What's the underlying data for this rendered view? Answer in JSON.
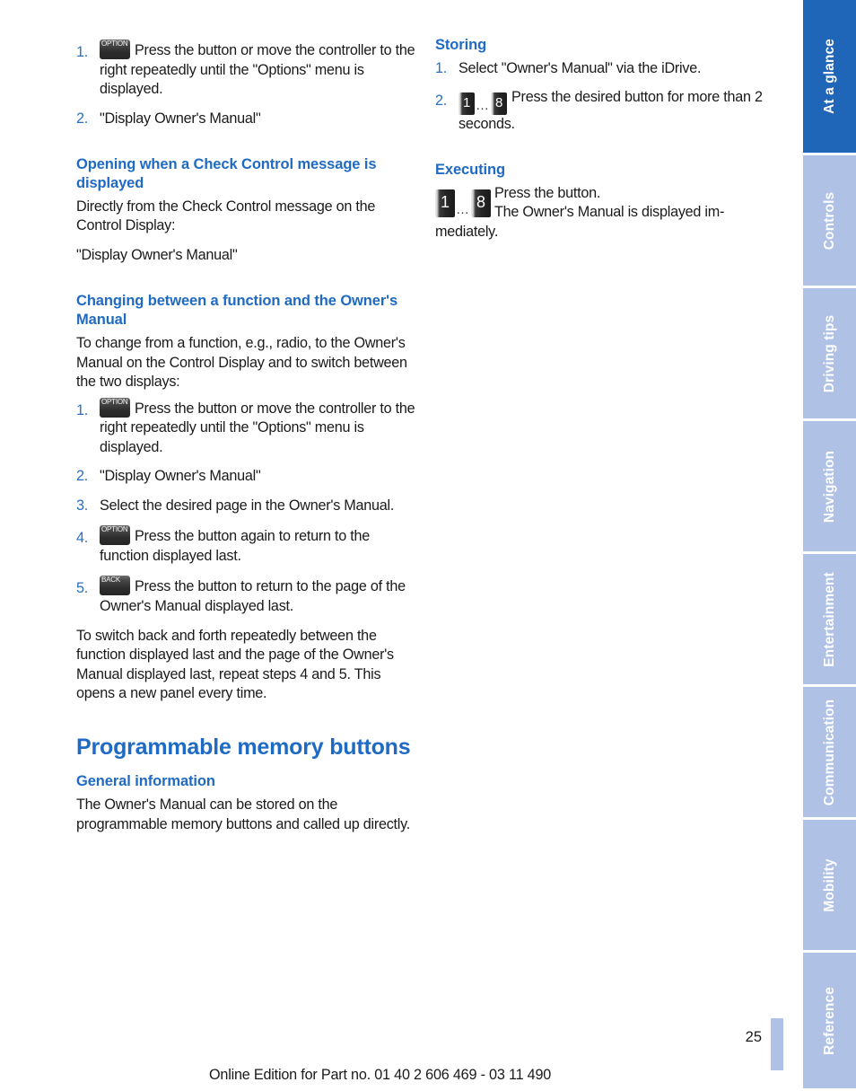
{
  "document": {
    "page_number": "25",
    "footer_text": "Online Edition for Part no. 01 40 2 606 469 - 03 11 490"
  },
  "colors": {
    "heading_blue": "#1f6ac2",
    "tab_active_blue": "#1f65b8",
    "tab_inactive_blue": "#afc1e4",
    "list_number_blue": "#2a6fc0",
    "body_text": "#1a1a1a"
  },
  "tab_rail": {
    "tabs": [
      {
        "label": "At a glance",
        "active": true
      },
      {
        "label": "Controls",
        "active": false
      },
      {
        "label": "Driving tips",
        "active": false
      },
      {
        "label": "Navigation",
        "active": false
      },
      {
        "label": "Entertainment",
        "active": false
      },
      {
        "label": "Communication",
        "active": false
      },
      {
        "label": "Mobility",
        "active": false
      },
      {
        "label": "Reference",
        "active": false
      }
    ]
  },
  "left_column": {
    "top_steps": [
      {
        "num": "1.",
        "icon": "OPTION",
        "text": "Press the button or move the controller to the right repeatedly until the \"Options\" menu is displayed."
      },
      {
        "num": "2.",
        "icon": null,
        "text": "\"Display Owner's Manual\""
      }
    ],
    "section_check_control": {
      "heading": "Opening when a Check Control message is displayed",
      "paragraph1": "Directly from the Check Control message on the Control Display:",
      "paragraph2": "\"Display Owner's Manual\""
    },
    "section_changing": {
      "heading": "Changing between a function and the Owner's Manual",
      "paragraph": "To change from a function, e.g., radio, to the Owner's Manual on the Control Display and to switch between the two displays:",
      "steps": [
        {
          "num": "1.",
          "icon": "OPTION",
          "text": "Press the button or move the controller to the right repeatedly until the \"Options\" menu is displayed."
        },
        {
          "num": "2.",
          "icon": null,
          "text": "\"Display Owner's Manual\""
        },
        {
          "num": "3.",
          "icon": null,
          "text": "Select the desired page in the Owner's Manual."
        },
        {
          "num": "4.",
          "icon": "OPTION",
          "text": "Press the button again to return to the function displayed last."
        },
        {
          "num": "5.",
          "icon": "BACK",
          "text": "Press the button to return to the page of the Owner's Manual displayed last."
        }
      ],
      "closing_paragraph": "To switch back and forth repeatedly between the function displayed last and the page of the Owner's Manual displayed last, repeat steps 4 and 5. This opens a new panel every time."
    },
    "section_memory_buttons": {
      "main_heading": "Programmable memory buttons",
      "sub_heading": "General information",
      "paragraph": "The Owner's Manual can be stored on the programmable memory buttons and called up directly."
    }
  },
  "right_column": {
    "section_storing": {
      "heading": "Storing",
      "steps": [
        {
          "num": "1.",
          "icon": null,
          "text": "Select \"Owner's Manual\" via the iDrive."
        },
        {
          "num": "2.",
          "icon": "MEMORY",
          "text": "Press the desired button for more than 2 seconds."
        }
      ]
    },
    "section_executing": {
      "heading": "Executing",
      "icon": "MEMORY",
      "line1": "Press the button.",
      "line2": "The Owner's Manual is displayed im-",
      "line3": "mediately."
    }
  },
  "icons": {
    "option_label": "OPTION",
    "back_label": "BACK",
    "memory_first": "1",
    "memory_last": "8",
    "memory_dots": "…"
  }
}
